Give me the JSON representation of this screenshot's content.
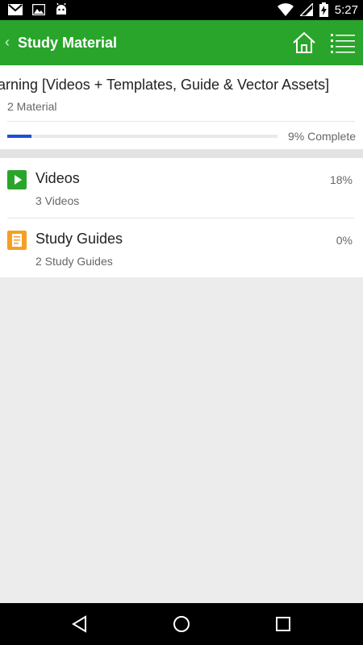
{
  "status_bar": {
    "time": "5:27",
    "left_icons": [
      "gmail-icon",
      "image-icon",
      "android-icon"
    ],
    "right_icons": [
      "wifi-icon",
      "signal-icon",
      "battery-charging-icon"
    ]
  },
  "app_bar": {
    "title": "Study Material",
    "back_glyph": "‹",
    "icons": [
      "home-icon",
      "menu-list-icon"
    ]
  },
  "course": {
    "title": "earning [Videos + Templates, Guide & Vector Assets]",
    "subtitle": "2 Material",
    "progress_fraction": 0.09,
    "progress_text": "9% Complete"
  },
  "materials": [
    {
      "name": "Videos",
      "count_text": "3 Videos",
      "percent_text": "18%",
      "icon": "play-icon",
      "color": "#2aa52b"
    },
    {
      "name": "Study Guides",
      "count_text": "2 Study Guides",
      "percent_text": "0%",
      "icon": "document-icon",
      "color": "#f5a023"
    }
  ],
  "colors": {
    "accent": "#2aa52b",
    "progress": "#1f4fd6",
    "guide": "#f5a023"
  },
  "nav_bar": {
    "icons": [
      "back-triangle-icon",
      "home-circle-icon",
      "recents-square-icon"
    ]
  }
}
